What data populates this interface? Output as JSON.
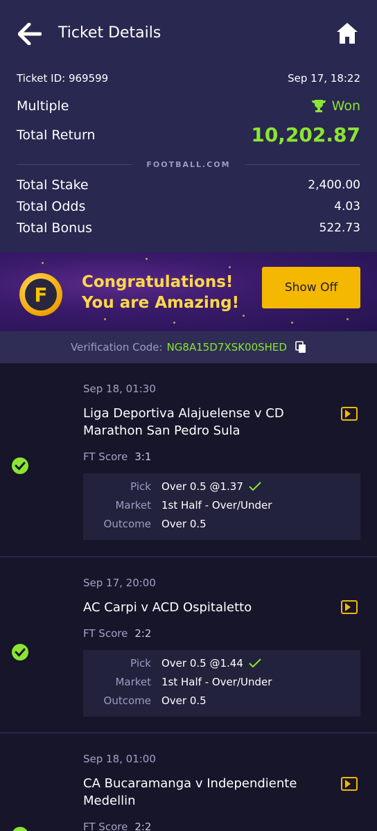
{
  "header": {
    "title": "Ticket Details",
    "back_icon": "arrow-left-icon",
    "home_icon": "home-icon"
  },
  "summary": {
    "ticket_id": "Ticket ID: 969599",
    "datetime": "Sep 17, 18:22",
    "type": "Multiple",
    "status": "Won",
    "total_return_label": "Total Return",
    "total_return_value": "10,202.87",
    "brand": "FOOTBALL.COM",
    "total_stake_label": "Total Stake",
    "total_stake_value": "2,400.00",
    "total_odds_label": "Total Odds",
    "total_odds_value": "4.03",
    "total_bonus_label": "Total Bonus",
    "total_bonus_value": "522.73"
  },
  "banner": {
    "coin_letter": "F",
    "line1": "Congratulations!",
    "line2": "You are Amazing!",
    "button": "Show Off"
  },
  "verification": {
    "label": "Verification Code:",
    "code": "NG8A15D7XSK00SHED"
  },
  "matches": [
    {
      "date": "Sep 18, 01:30",
      "name": "Liga Deportiva Alajuelense v CD Marathon San Pedro Sula",
      "score_label": "FT Score",
      "score": "3:1",
      "pick_label": "Pick",
      "pick": "Over 0.5 @1.37",
      "market_label": "Market",
      "market": "1st Half - Over/Under",
      "outcome_label": "Outcome",
      "outcome": "Over 0.5"
    },
    {
      "date": "Sep 17, 20:00",
      "name": "AC Carpi v ACD Ospitaletto",
      "score_label": "FT Score",
      "score": "2:2",
      "pick_label": "Pick",
      "pick": "Over 0.5 @1.44",
      "market_label": "Market",
      "market": "1st Half - Over/Under",
      "outcome_label": "Outcome",
      "outcome": "Over 0.5"
    },
    {
      "date": "Sep 18, 01:00",
      "name": "CA Bucaramanga v Independiente Medellin",
      "score_label": "FT Score",
      "score": "2:2"
    }
  ],
  "colors": {
    "accent_green": "#8be532",
    "brand_yellow": "#f5b800",
    "header_bg": "#292850",
    "page_bg": "#16152a"
  }
}
